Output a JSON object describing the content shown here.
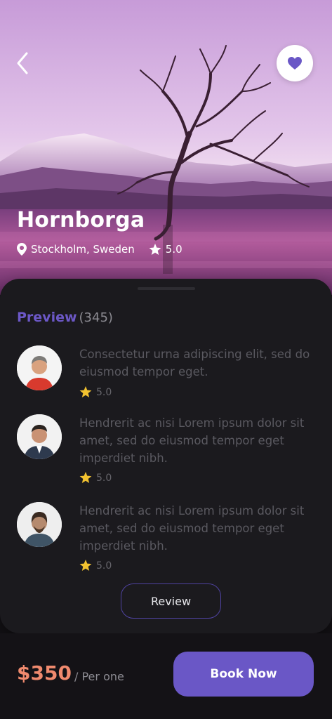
{
  "place": {
    "title": "Hornborga",
    "location": "Stockholm, Sweden",
    "rating": "5.0"
  },
  "icons": {
    "back": "chevron-left-icon",
    "favorite": "heart-icon",
    "location": "map-pin-icon",
    "star": "star-icon"
  },
  "colors": {
    "accent": "#6a57c6",
    "price": "#f08a6e",
    "star": "#f2c230"
  },
  "preview": {
    "label": "Preview",
    "count": "(345)"
  },
  "reviews": [
    {
      "text": "Consectetur  urna adipiscing elit, sed do eiusmod tempor eget.",
      "rating": "5.0"
    },
    {
      "text": "Hendrerit ac nisi Lorem ipsum dolor sit amet, sed do eiusmod tempor eget imperdiet nibh.",
      "rating": "5.0"
    },
    {
      "text": "Hendrerit ac nisi Lorem ipsum dolor sit amet, sed do eiusmod tempor eget imperdiet nibh.",
      "rating": "5.0"
    }
  ],
  "review_button": "Review",
  "footer": {
    "price": "$350",
    "per": "/ Per one",
    "book_button": "Book Now"
  }
}
